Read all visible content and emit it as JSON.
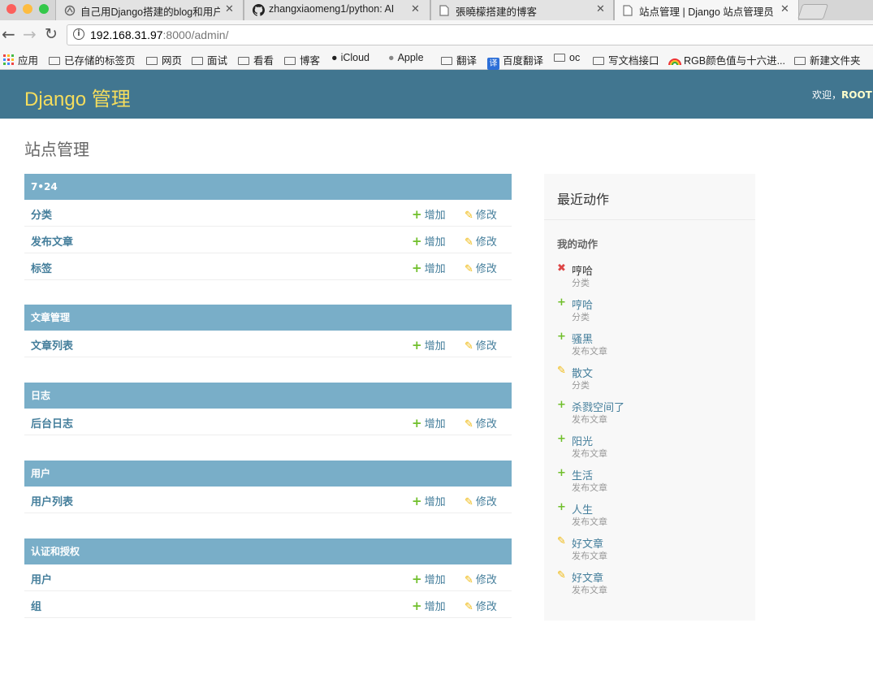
{
  "browser": {
    "tabs": [
      {
        "label": "自己用Django搭建的blog和用户",
        "icon": "page-icon"
      },
      {
        "label": "zhangxiaomeng1/python: AI",
        "icon": "github-icon"
      },
      {
        "label": "張曉檬搭建的博客",
        "icon": "document-icon"
      },
      {
        "label": "站点管理 | Django 站点管理员",
        "icon": "document-icon"
      }
    ],
    "url_host": "192.168.31.97",
    "url_rest": ":8000/admin/",
    "bookmarks": [
      {
        "label": "应用",
        "icon": "apps-grid-icon"
      },
      {
        "label": "已存储的标签页",
        "icon": "folder-icon"
      },
      {
        "label": "网页",
        "icon": "folder-icon"
      },
      {
        "label": "面试",
        "icon": "folder-icon"
      },
      {
        "label": "看看",
        "icon": "folder-icon"
      },
      {
        "label": "博客",
        "icon": "folder-icon"
      },
      {
        "label": "iCloud",
        "icon": "apple-icon"
      },
      {
        "label": "Apple",
        "icon": "apple-icon"
      },
      {
        "label": "翻译",
        "icon": "folder-icon"
      },
      {
        "label": "百度翻译",
        "icon": "translate-icon"
      },
      {
        "label": "oc",
        "icon": "folder-icon"
      },
      {
        "label": "写文档接口",
        "icon": "folder-icon"
      },
      {
        "label": "RGB颜色值与十六进...",
        "icon": "rainbow-icon"
      },
      {
        "label": "新建文件夹",
        "icon": "folder-icon"
      }
    ]
  },
  "header": {
    "brand": "Django 管理",
    "welcome": "欢迎，",
    "username": "ROOT"
  },
  "page_title": "站点管理",
  "actions": {
    "add": "增加",
    "change": "修改"
  },
  "modules": [
    {
      "caption": "7•24",
      "models": [
        "分类",
        "发布文章",
        "标签"
      ]
    },
    {
      "caption": "文章管理",
      "models": [
        "文章列表"
      ]
    },
    {
      "caption": "日志",
      "models": [
        "后台日志"
      ]
    },
    {
      "caption": "用户",
      "models": [
        "用户列表"
      ]
    },
    {
      "caption": "认证和授权",
      "models": [
        "用户",
        "组"
      ]
    }
  ],
  "recent": {
    "title": "最近动作",
    "subtitle": "我的动作",
    "items": [
      {
        "type": "delete",
        "name": "哼哈",
        "model": "分类"
      },
      {
        "type": "add",
        "name": "哼哈",
        "model": "分类"
      },
      {
        "type": "add",
        "name": "骚黑",
        "model": "发布文章"
      },
      {
        "type": "change",
        "name": "散文",
        "model": "分类"
      },
      {
        "type": "add",
        "name": "杀戮空间了",
        "model": "发布文章"
      },
      {
        "type": "add",
        "name": "阳光",
        "model": "发布文章"
      },
      {
        "type": "add",
        "name": "生活",
        "model": "发布文章"
      },
      {
        "type": "add",
        "name": "人生",
        "model": "发布文章"
      },
      {
        "type": "change",
        "name": "好文章",
        "model": "发布文章"
      },
      {
        "type": "change",
        "name": "好文章",
        "model": "发布文章"
      }
    ]
  },
  "colors": {
    "header_bg": "#417690",
    "brand": "#f5dd5d",
    "caption_bg": "#79aec8",
    "link": "#447e9b",
    "add_icon": "#70bf2b",
    "change_icon": "#efb80b",
    "delete_icon": "#dd4646"
  }
}
